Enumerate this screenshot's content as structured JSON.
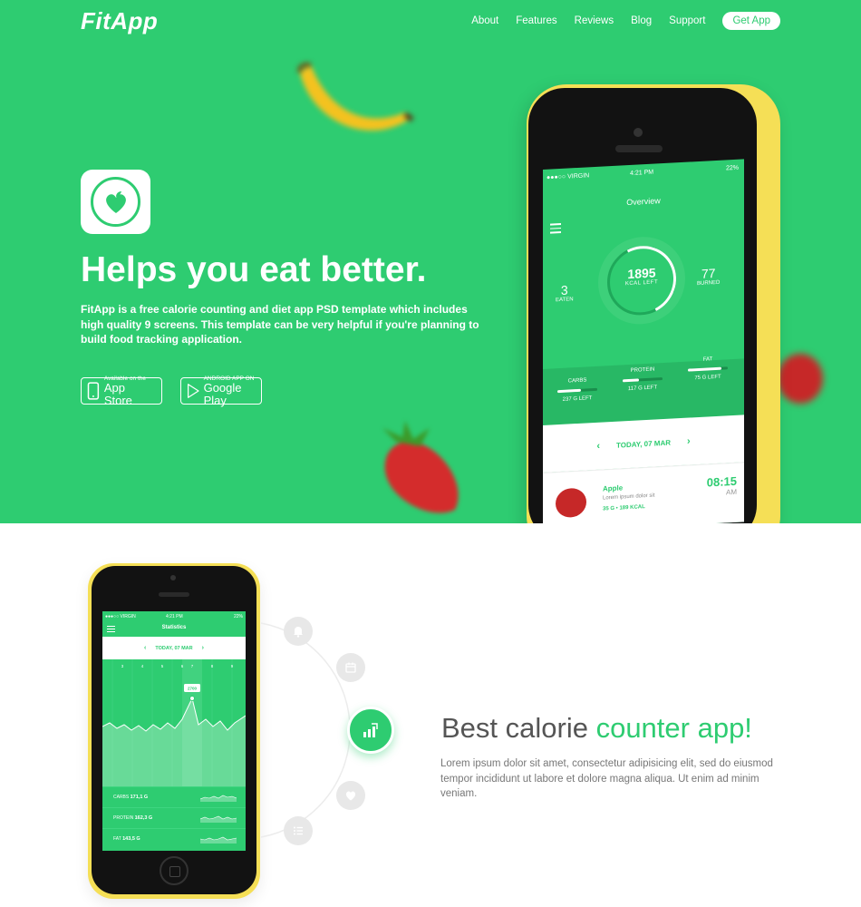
{
  "nav": {
    "logo": "FitApp",
    "links": [
      "About",
      "Features",
      "Reviews",
      "Blog",
      "Support"
    ],
    "cta": "Get App"
  },
  "hero": {
    "headline_light": "Helps you eat ",
    "headline_bold": "better.",
    "description": "FitApp is a free calorie counting and diet app PSD template which includes high quality 9 screens. This template can be very helpful if you're planning to build food tracking application.",
    "appstore_small": "Available on the",
    "appstore_big": "App Store",
    "googleplay_small": "ANDROID APP ON",
    "googleplay_big": "Google Play"
  },
  "phone1": {
    "carrier": "●●●○○ VIRGIN",
    "time": "4:21 PM",
    "battery": "22%",
    "title": "Overview",
    "eaten_value": "3",
    "eaten_label": "EATEN",
    "kcal_value": "1895",
    "kcal_label": "KCAL LEFT",
    "burned_value": "77",
    "burned_label": "BURNED",
    "macros": [
      {
        "label": "CARBS",
        "value": "237 G LEFT",
        "fill": 0.6
      },
      {
        "label": "PROTEIN",
        "value": "117 G LEFT",
        "fill": 0.4
      },
      {
        "label": "FAT",
        "value": "75 G LEFT",
        "fill": 0.85
      }
    ],
    "date": "TODAY, 07 MAR",
    "food": {
      "name": "Apple",
      "desc": "Lorem ipsum dolor sit",
      "meta": "35 G  •  189 KCAL",
      "time": "08:15",
      "ampm": "AM"
    }
  },
  "phone2": {
    "carrier": "●●●○○ VIRGIN",
    "time": "4:21 PM",
    "battery": "22%",
    "title": "Statistics",
    "date": "TODAY, 07 MAR",
    "days": [
      "3",
      "4",
      "5",
      "6",
      "7",
      "8",
      "9"
    ],
    "tooltip": "2700",
    "rows": [
      {
        "label": "CARBS",
        "value": "171,1 G"
      },
      {
        "label": "PROTEIN",
        "value": "162,3 G"
      },
      {
        "label": "FAT",
        "value": "143,5 G"
      }
    ]
  },
  "feature": {
    "title_plain": "Best calorie ",
    "title_accent": "counter app!",
    "description": "Lorem ipsum dolor sit amet, consectetur adipisicing elit, sed do eiusmod tempor incididunt ut labore et dolore magna aliqua. Ut enim ad minim veniam."
  },
  "colors": {
    "brand_green": "#2ecc71",
    "phone_yellow": "#f5df56"
  }
}
